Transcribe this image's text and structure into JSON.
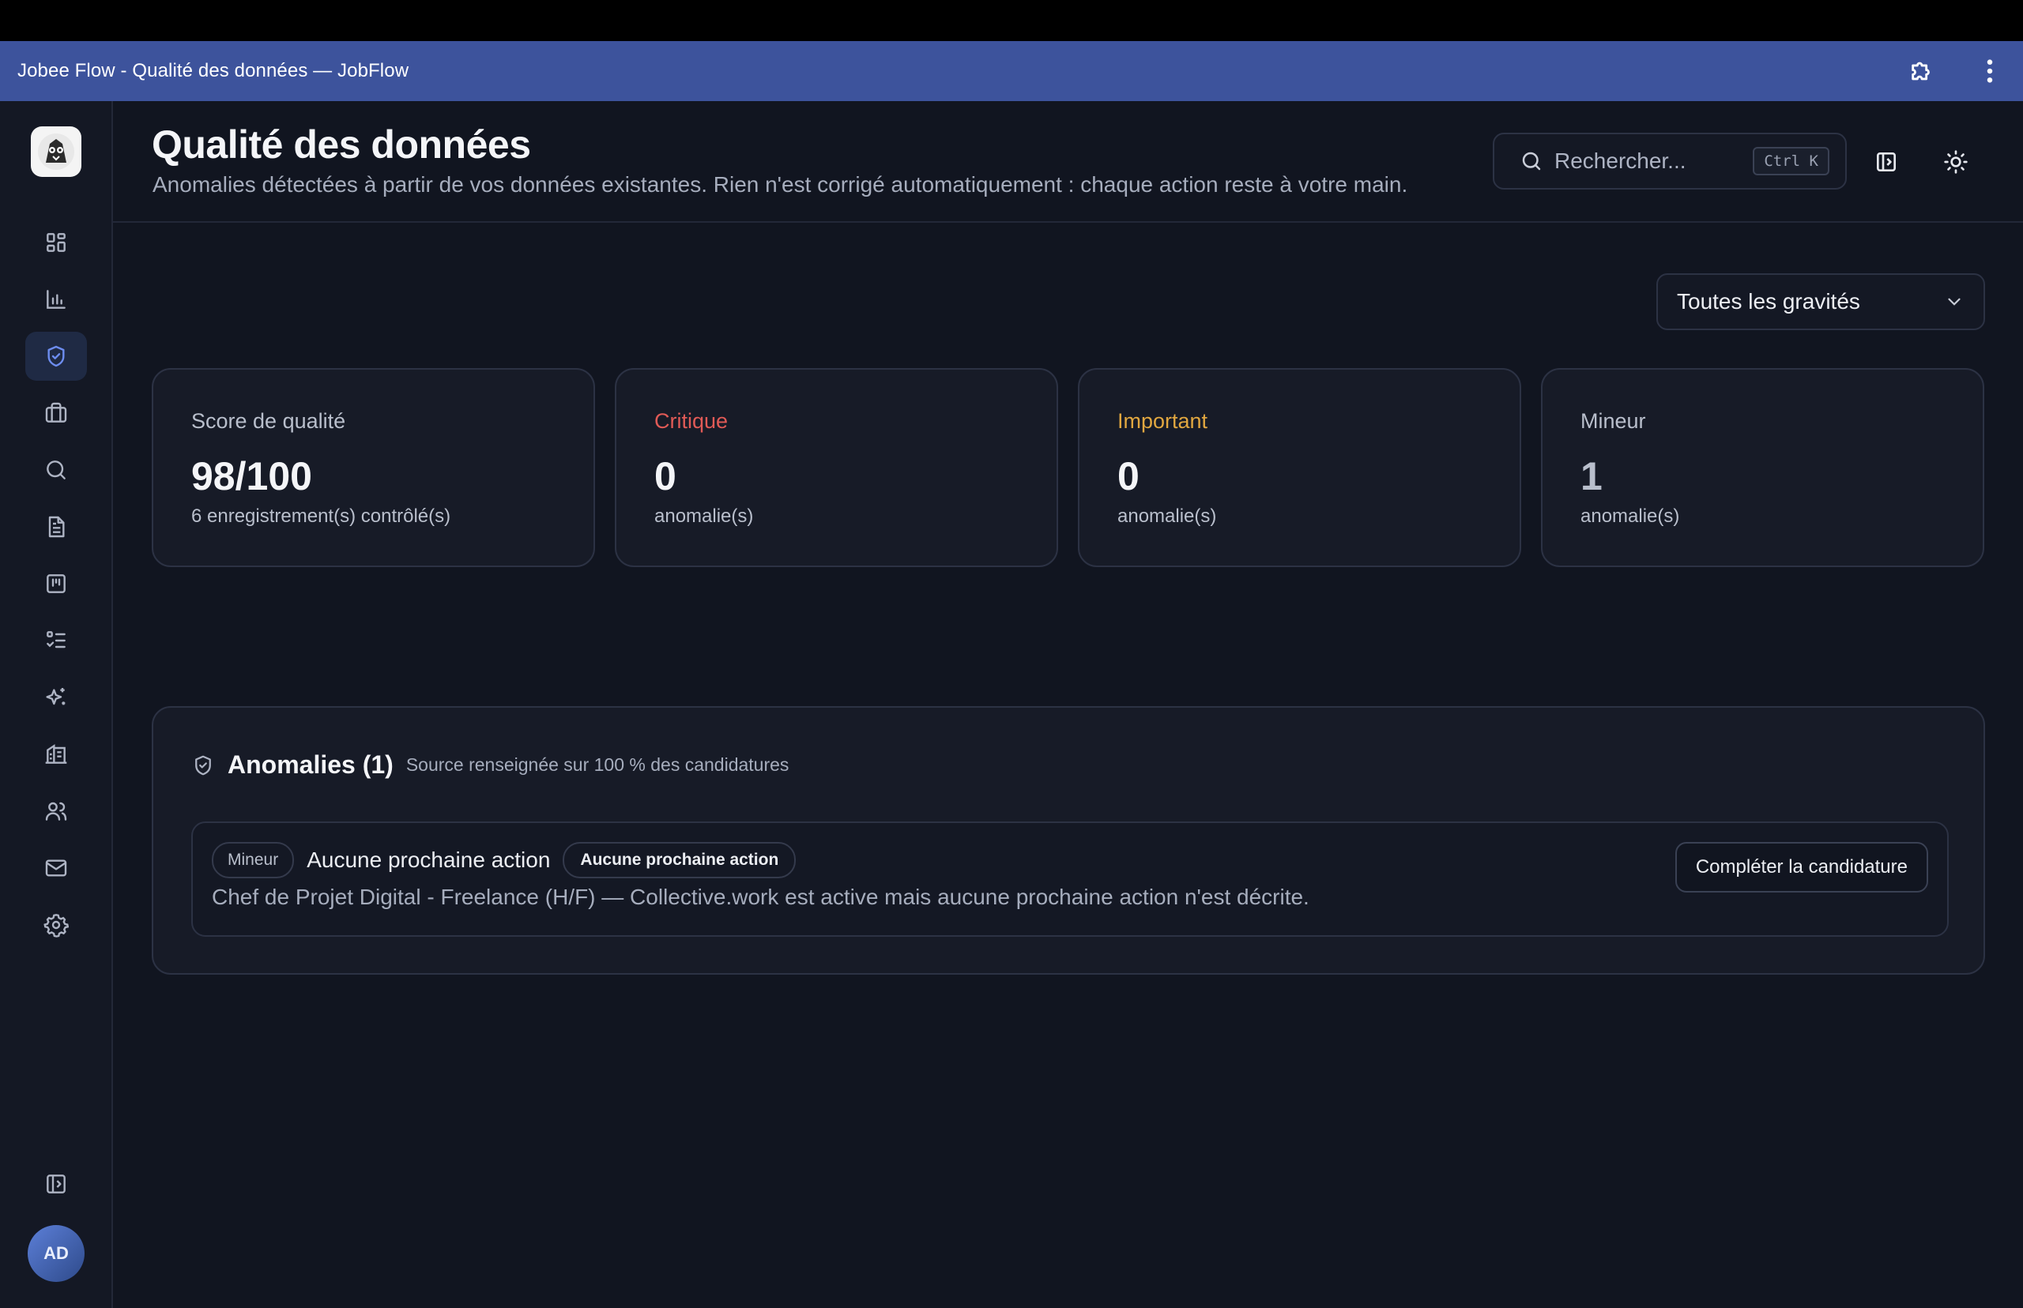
{
  "window": {
    "title": "Jobee Flow - Qualité des données — JobFlow"
  },
  "sidebar": {
    "items": [
      {
        "name": "dashboard",
        "icon": "dashboard-grid-icon",
        "active": false
      },
      {
        "name": "analytics",
        "icon": "bar-chart-icon",
        "active": false
      },
      {
        "name": "data-quality",
        "icon": "shield-check-icon",
        "active": true
      },
      {
        "name": "jobs",
        "icon": "briefcase-icon",
        "active": false
      },
      {
        "name": "search",
        "icon": "search-icon",
        "active": false
      },
      {
        "name": "documents",
        "icon": "document-icon",
        "active": false
      },
      {
        "name": "kanban",
        "icon": "kanban-board-icon",
        "active": false
      },
      {
        "name": "tasks",
        "icon": "checklist-icon",
        "active": false
      },
      {
        "name": "ai",
        "icon": "sparkles-icon",
        "active": false
      },
      {
        "name": "companies",
        "icon": "building-icon",
        "active": false
      },
      {
        "name": "contacts",
        "icon": "users-icon",
        "active": false
      },
      {
        "name": "mail",
        "icon": "mail-icon",
        "active": false
      },
      {
        "name": "settings",
        "icon": "gear-icon",
        "active": false
      }
    ],
    "avatar_initials": "AD"
  },
  "header": {
    "title": "Qualité des données",
    "subtitle": "Anomalies détectées à partir de vos données existantes. Rien n'est corrigé automatiquement : chaque action reste à votre main.",
    "search": {
      "placeholder": "Rechercher...",
      "shortcut": "Ctrl K"
    }
  },
  "filters": {
    "severity_selected": "Toutes les gravités"
  },
  "stats": [
    {
      "label": "Score de qualité",
      "value": "98/100",
      "sub": "6 enregistrement(s) contrôlé(s)"
    },
    {
      "label": "Critique",
      "value": "0",
      "sub": "anomalie(s)",
      "color": "#e05a56"
    },
    {
      "label": "Important",
      "value": "0",
      "sub": "anomalie(s)",
      "color": "#e1a740"
    },
    {
      "label": "Mineur",
      "value": "1",
      "sub": "anomalie(s)"
    }
  ],
  "anomalies": {
    "title": "Anomalies (1)",
    "note": "Source renseignée sur 100 % des candidatures",
    "items": [
      {
        "severity": "Mineur",
        "title": "Aucune prochaine action",
        "tag": "Aucune prochaine action",
        "description": "Chef de Projet Digital - Freelance (H/F) — Collective.work est active mais aucune prochaine action n'est décrite.",
        "action": "Compléter la candidature"
      }
    ]
  },
  "colors": {
    "accent": "#6d8df0",
    "titlebar": "#3d539c",
    "background": "#111520"
  }
}
